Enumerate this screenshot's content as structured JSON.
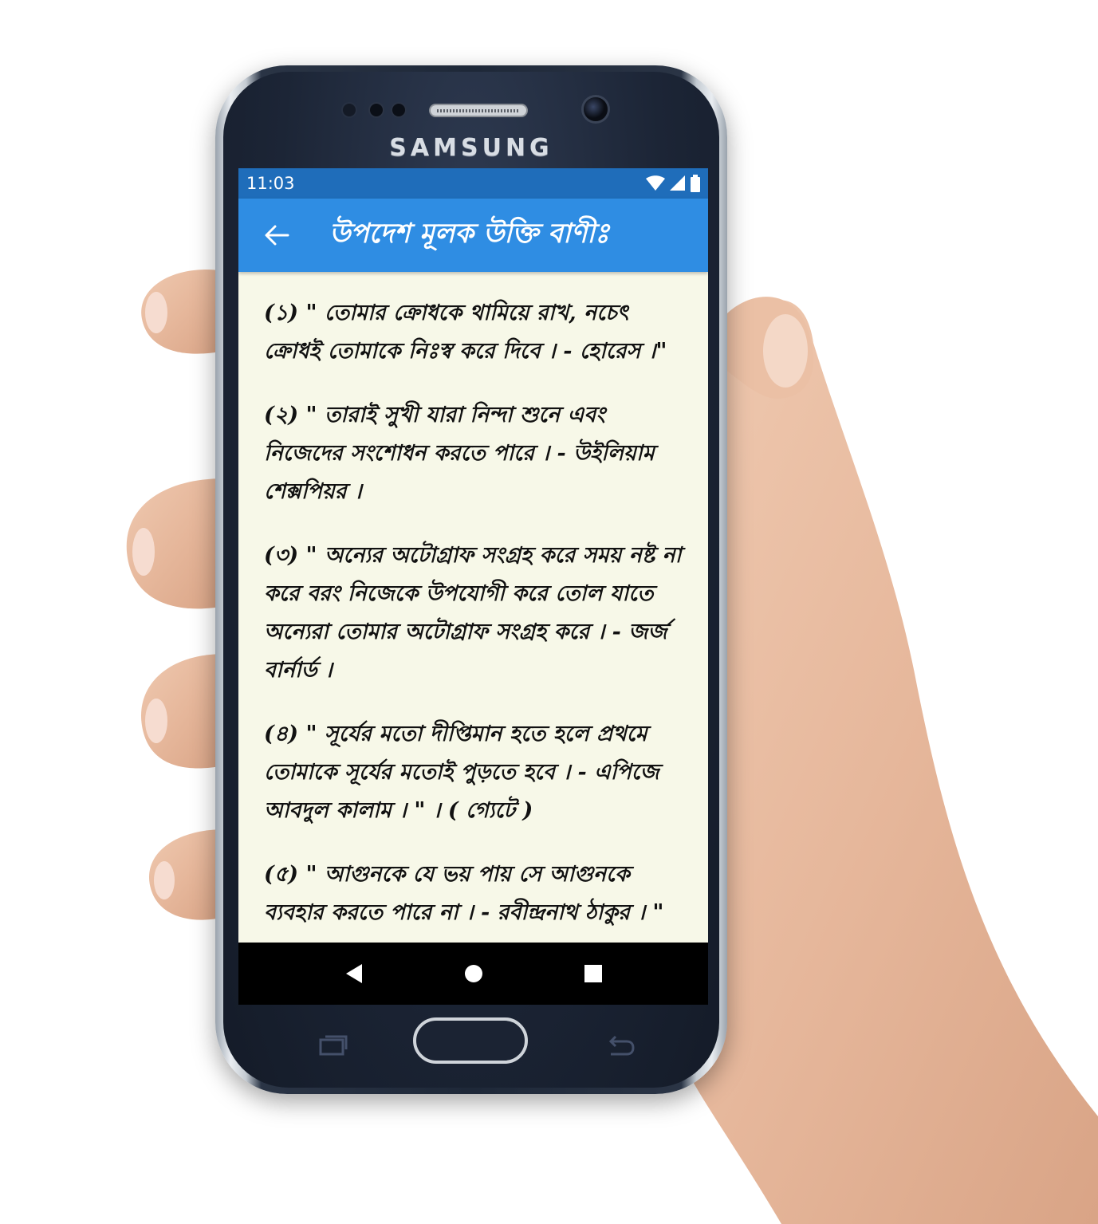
{
  "device": {
    "brand": "SAMSUNG"
  },
  "status_bar": {
    "time": "11:03",
    "icons": [
      "wifi-icon",
      "signal-icon",
      "battery-icon"
    ]
  },
  "app_bar": {
    "back_icon": "arrow-left-icon",
    "title": "উপদেশ মূলক উক্তি বাণীঃ"
  },
  "quotes": [
    {
      "text": "(১) \" তোমার ক্রোধকে থামিয়ে রাখ, নচেৎ ক্রোধই তোমাকে নিঃস্ব করে দিবে । - হোরেস ।\""
    },
    {
      "text": "(২) \" তারাই সুখী যারা নিন্দা শুনে এবং নিজেদের সংশোধন করতে পারে । - উইলিয়াম শেক্সপিয়র ।"
    },
    {
      "text": "(৩) \" অন্যের অটোগ্রাফ সংগ্রহ করে সময় নষ্ট না করে বরং নিজেকে উপযোগী করে তোল যাতে অন্যেরা তোমার অটোগ্রাফ সংগ্রহ করে । - জর্জ বার্নার্ড ।"
    },
    {
      "text": "(৪) \" সূর্যের মতো দীপ্তিমান হতে হলে প্রথমে তোমাকে সূর্যের মতোই পুড়তে হবে । - এপিজে আবদুল কালাম । \" । ( গ্যেটে )"
    },
    {
      "text": "(৫) \" আগুনকে যে ভয় পায় সে আগুনকে ব্যবহার করতে পারে না । - রবীন্দ্রনাথ ঠাকুর । \""
    }
  ],
  "nav_bar": {
    "keys": [
      "back-triangle-icon",
      "home-circle-icon",
      "recents-square-icon"
    ]
  },
  "colors": {
    "status_bar": "#1f6dba",
    "app_bar": "#2f8de3",
    "content_bg": "#f7f8e8",
    "nav_bar": "#000000"
  }
}
